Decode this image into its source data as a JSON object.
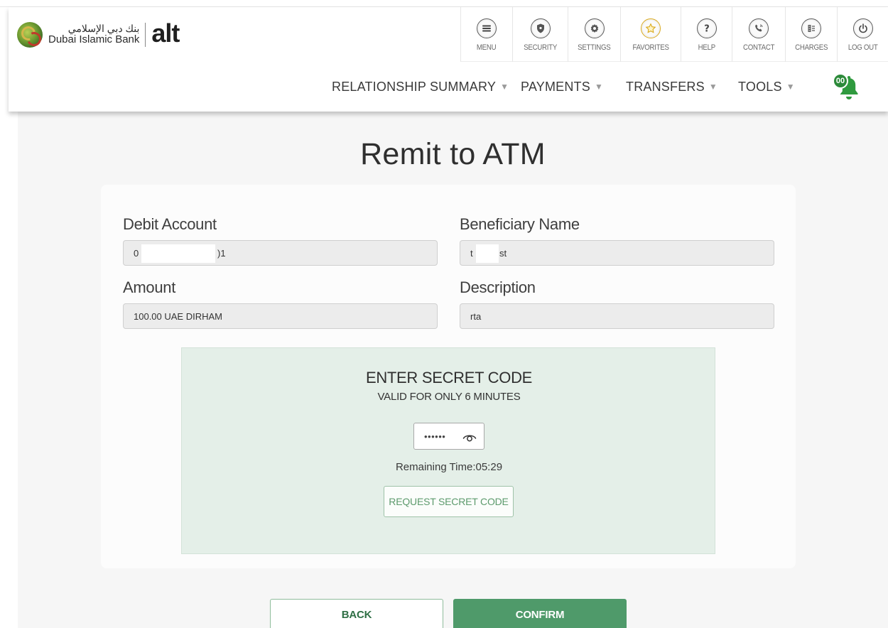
{
  "brand": {
    "arabic_name": "بنك دبي الإسلامي",
    "english_name": "Dubai Islamic Bank",
    "product": "alt"
  },
  "top_icons": [
    {
      "label": "MENU",
      "icon": "menu-icon"
    },
    {
      "label": "SECURITY",
      "icon": "shield-icon"
    },
    {
      "label": "SETTINGS",
      "icon": "gear-icon"
    },
    {
      "label": "FAVORITES",
      "icon": "star-icon"
    },
    {
      "label": "HELP",
      "icon": "question-icon"
    },
    {
      "label": "CONTACT",
      "icon": "phone-icon"
    },
    {
      "label": "CHARGES",
      "icon": "charges-icon"
    },
    {
      "label": "LOG OUT",
      "icon": "power-icon"
    }
  ],
  "nav": {
    "items": [
      "RELATIONSHIP SUMMARY",
      "PAYMENTS",
      "TRANSFERS",
      "TOOLS"
    ],
    "notification_count": "00"
  },
  "page": {
    "title": "Remit to ATM"
  },
  "form": {
    "debit_account_label": "Debit Account",
    "debit_account_value_start": "0",
    "debit_account_value_end": ")1",
    "beneficiary_label": "Beneficiary Name",
    "beneficiary_value_start": "t",
    "beneficiary_value_end": "st",
    "amount_label": "Amount",
    "amount_value": "100.00 UAE DIRHAM",
    "description_label": "Description",
    "description_value": "rta"
  },
  "secret": {
    "title": "ENTER SECRET CODE",
    "subtitle": "VALID FOR ONLY 6 MINUTES",
    "masked_code": "••••••",
    "remaining_time": "Remaining Time:05:29",
    "request_label": "REQUEST SECRET CODE"
  },
  "actions": {
    "back_label": "BACK",
    "confirm_label": "CONFIRM"
  },
  "colors": {
    "primary_green": "#4f9a6a",
    "secret_panel": "#e4efe8",
    "notification_green": "#2c8a3a"
  }
}
